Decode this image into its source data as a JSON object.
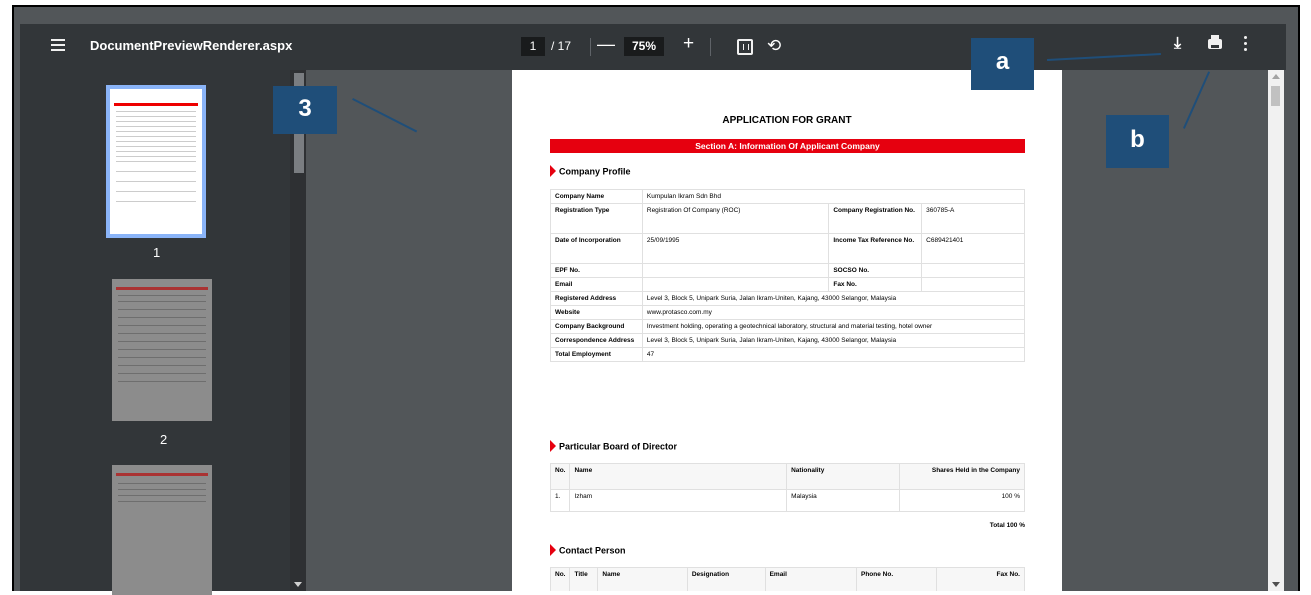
{
  "toolbar": {
    "title": "DocumentPreviewRenderer.aspx",
    "page_current": "1",
    "page_total": "/ 17",
    "zoom_minus": "—",
    "zoom": "75%",
    "zoom_plus": "+",
    "rotate_glyph": "⟲",
    "download_glyph": "⤓"
  },
  "sidebar": {
    "pages": [
      "1",
      "2"
    ]
  },
  "callouts": {
    "three": "3",
    "a": "a",
    "b": "b"
  },
  "document": {
    "title": "APPLICATION FOR GRANT",
    "section_a": "Section A: Information Of Applicant Company",
    "company_profile": {
      "heading": "Company Profile",
      "company_name_label": "Company Name",
      "company_name": "Kumpulan Ikram Sdn Bhd",
      "registration_type_label": "Registration Type",
      "registration_type": "Registration Of Company (ROC)",
      "company_reg_no_label": "Company Registration No.",
      "company_reg_no": "360785-A",
      "date_inc_label": "Date of Incorporation",
      "date_inc": "25/09/1995",
      "income_tax_label": "Income Tax Reference No.",
      "income_tax": "C689421401",
      "epf_label": "EPF No.",
      "socso_label": "SOCSO No.",
      "email_label": "Email",
      "fax_label": "Fax No.",
      "reg_address_label": "Registered Address",
      "reg_address": "Level 3, Block 5, Unipark Suria, Jalan Ikram-Uniten, Kajang,  43000 Selangor, Malaysia",
      "website_label": "Website",
      "website": "www.protasco.com.my",
      "background_label": "Company Background",
      "background": "Investment holding, operating a geotechnical laboratory, structural and material testing, hotel owner",
      "corr_address_label": "Correspondence Address",
      "corr_address": "Level 3, Block 5, Unipark Suria, Jalan Ikram-Uniten, Kajang,  43000 Selangor, Malaysia",
      "employment_label": "Total Employment",
      "employment": "47"
    },
    "board": {
      "heading": "Particular Board of Director",
      "col_no": "No.",
      "col_name": "Name",
      "col_nationality": "Nationality",
      "col_shares": "Shares Held in the Company",
      "row_no": "1.",
      "row_name": "Izham",
      "row_nationality": "Malaysia",
      "row_shares": "100 %",
      "total": "Total 100 %"
    },
    "contact": {
      "heading": "Contact Person",
      "col_no": "No.",
      "col_title": "Title",
      "col_name": "Name",
      "col_designation": "Designation",
      "col_email": "Email",
      "col_phone": "Phone No.",
      "col_fax": "Fax No."
    }
  }
}
